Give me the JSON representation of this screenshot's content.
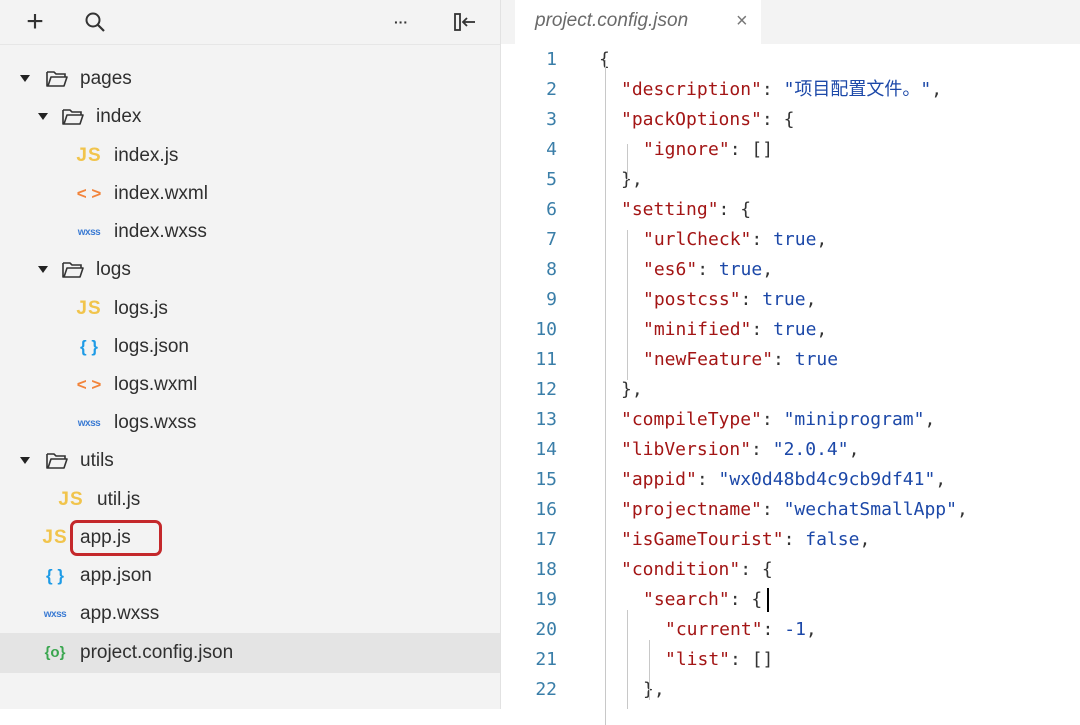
{
  "explorer": {
    "toolbar": {
      "add_icon": "plus-icon",
      "search_icon": "search-icon",
      "more_icon": "ellipsis-icon",
      "collapse_icon": "collapse-sidebar-icon",
      "add_glyph": "+",
      "more_glyph": "···"
    },
    "tree": [
      {
        "label": "pages",
        "type": "folder",
        "icon_text": ""
      },
      {
        "label": "index",
        "type": "folder",
        "icon_text": ""
      },
      {
        "label": "index.js",
        "type": "js",
        "icon_text": "JS"
      },
      {
        "label": "index.wxml",
        "type": "wxml",
        "icon_text": "< >"
      },
      {
        "label": "index.wxss",
        "type": "wxss",
        "icon_text": "wxss"
      },
      {
        "label": "logs",
        "type": "folder",
        "icon_text": ""
      },
      {
        "label": "logs.js",
        "type": "js",
        "icon_text": "JS"
      },
      {
        "label": "logs.json",
        "type": "json",
        "icon_text": "{ }"
      },
      {
        "label": "logs.wxml",
        "type": "wxml",
        "icon_text": "< >"
      },
      {
        "label": "logs.wxss",
        "type": "wxss",
        "icon_text": "wxss"
      },
      {
        "label": "utils",
        "type": "folder",
        "icon_text": ""
      },
      {
        "label": "util.js",
        "type": "js",
        "icon_text": "JS"
      },
      {
        "label": "app.js",
        "type": "js",
        "icon_text": "JS",
        "highlighted": true
      },
      {
        "label": "app.json",
        "type": "json",
        "icon_text": "{ }"
      },
      {
        "label": "app.wxss",
        "type": "wxss",
        "icon_text": "wxss"
      },
      {
        "label": "project.config.json",
        "type": "config",
        "icon_text": "{o}",
        "selected": true
      }
    ]
  },
  "editor": {
    "tab": {
      "label": "project.config.json",
      "close": "×"
    },
    "line_numbers": [
      "1",
      "2",
      "3",
      "4",
      "5",
      "6",
      "7",
      "8",
      "9",
      "10",
      "11",
      "12",
      "13",
      "14",
      "15",
      "16",
      "17",
      "18",
      "19",
      "20",
      "21",
      "22"
    ],
    "lines": [
      [
        {
          "t": "p",
          "v": "{"
        }
      ],
      [
        {
          "t": "k",
          "v": "\"description\""
        },
        {
          "t": "p",
          "v": ": "
        },
        {
          "t": "s",
          "v": "\"项目配置文件。\""
        },
        {
          "t": "p",
          "v": ","
        }
      ],
      [
        {
          "t": "k",
          "v": "\"packOptions\""
        },
        {
          "t": "p",
          "v": ": {"
        }
      ],
      [
        {
          "t": "k",
          "v": "\"ignore\""
        },
        {
          "t": "p",
          "v": ": []"
        }
      ],
      [
        {
          "t": "p",
          "v": "},"
        }
      ],
      [
        {
          "t": "k",
          "v": "\"setting\""
        },
        {
          "t": "p",
          "v": ": {"
        }
      ],
      [
        {
          "t": "k",
          "v": "\"urlCheck\""
        },
        {
          "t": "p",
          "v": ": "
        },
        {
          "t": "n",
          "v": "true"
        },
        {
          "t": "p",
          "v": ","
        }
      ],
      [
        {
          "t": "k",
          "v": "\"es6\""
        },
        {
          "t": "p",
          "v": ": "
        },
        {
          "t": "n",
          "v": "true"
        },
        {
          "t": "p",
          "v": ","
        }
      ],
      [
        {
          "t": "k",
          "v": "\"postcss\""
        },
        {
          "t": "p",
          "v": ": "
        },
        {
          "t": "n",
          "v": "true"
        },
        {
          "t": "p",
          "v": ","
        }
      ],
      [
        {
          "t": "k",
          "v": "\"minified\""
        },
        {
          "t": "p",
          "v": ": "
        },
        {
          "t": "n",
          "v": "true"
        },
        {
          "t": "p",
          "v": ","
        }
      ],
      [
        {
          "t": "k",
          "v": "\"newFeature\""
        },
        {
          "t": "p",
          "v": ": "
        },
        {
          "t": "n",
          "v": "true"
        }
      ],
      [
        {
          "t": "p",
          "v": "},"
        }
      ],
      [
        {
          "t": "k",
          "v": "\"compileType\""
        },
        {
          "t": "p",
          "v": ": "
        },
        {
          "t": "s",
          "v": "\"miniprogram\""
        },
        {
          "t": "p",
          "v": ","
        }
      ],
      [
        {
          "t": "k",
          "v": "\"libVersion\""
        },
        {
          "t": "p",
          "v": ": "
        },
        {
          "t": "s",
          "v": "\"2.0.4\""
        },
        {
          "t": "p",
          "v": ","
        }
      ],
      [
        {
          "t": "k",
          "v": "\"appid\""
        },
        {
          "t": "p",
          "v": ": "
        },
        {
          "t": "s",
          "v": "\"wx0d48bd4c9cb9df41\""
        },
        {
          "t": "p",
          "v": ","
        }
      ],
      [
        {
          "t": "k",
          "v": "\"projectname\""
        },
        {
          "t": "p",
          "v": ": "
        },
        {
          "t": "s",
          "v": "\"wechatSmallApp\""
        },
        {
          "t": "p",
          "v": ","
        }
      ],
      [
        {
          "t": "k",
          "v": "\"isGameTourist\""
        },
        {
          "t": "p",
          "v": ": "
        },
        {
          "t": "n",
          "v": "false"
        },
        {
          "t": "p",
          "v": ","
        }
      ],
      [
        {
          "t": "k",
          "v": "\"condition\""
        },
        {
          "t": "p",
          "v": ": {"
        }
      ],
      [
        {
          "t": "k",
          "v": "\"search\""
        },
        {
          "t": "p",
          "v": ": {"
        }
      ],
      [
        {
          "t": "k",
          "v": "\"current\""
        },
        {
          "t": "p",
          "v": ": "
        },
        {
          "t": "n",
          "v": "-1"
        },
        {
          "t": "p",
          "v": ","
        }
      ],
      [
        {
          "t": "k",
          "v": "\"list\""
        },
        {
          "t": "p",
          "v": ": []"
        }
      ],
      [
        {
          "t": "p",
          "v": "},"
        }
      ]
    ]
  }
}
